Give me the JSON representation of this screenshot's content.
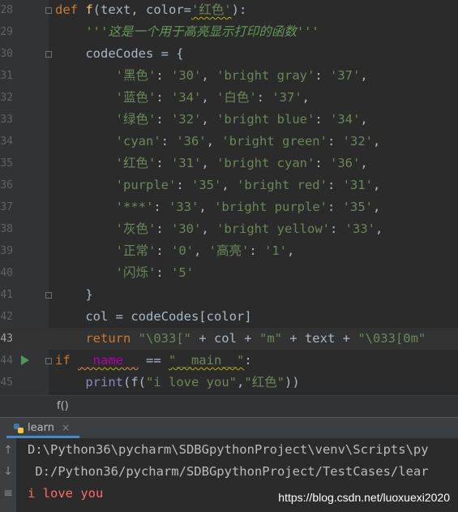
{
  "editor": {
    "lines": [
      {
        "num": "28",
        "tokens": [
          {
            "t": "kw",
            "v": "def "
          },
          {
            "t": "fn",
            "v": "f"
          },
          {
            "t": "id",
            "v": "(text, color="
          },
          {
            "t": "str",
            "v": "'红色'"
          },
          {
            "t": "id",
            "v": "):"
          }
        ]
      },
      {
        "num": "29",
        "tokens": [
          {
            "t": "id",
            "v": "    "
          },
          {
            "t": "doc",
            "v": "'''这是一个用于高亮显示打印的函数'''"
          }
        ]
      },
      {
        "num": "30",
        "tokens": [
          {
            "t": "id",
            "v": "    codeCodes = {"
          }
        ]
      },
      {
        "num": "31",
        "tokens": [
          {
            "t": "id",
            "v": "        "
          },
          {
            "t": "str",
            "v": "'黑色'"
          },
          {
            "t": "id",
            "v": ": "
          },
          {
            "t": "str",
            "v": "'30'"
          },
          {
            "t": "id",
            "v": ", "
          },
          {
            "t": "str",
            "v": "'bright gray'"
          },
          {
            "t": "id",
            "v": ": "
          },
          {
            "t": "str",
            "v": "'37'"
          },
          {
            "t": "id",
            "v": ","
          }
        ]
      },
      {
        "num": "32",
        "tokens": [
          {
            "t": "id",
            "v": "        "
          },
          {
            "t": "str",
            "v": "'蓝色'"
          },
          {
            "t": "id",
            "v": ": "
          },
          {
            "t": "str",
            "v": "'34'"
          },
          {
            "t": "id",
            "v": ", "
          },
          {
            "t": "str",
            "v": "'白色'"
          },
          {
            "t": "id",
            "v": ": "
          },
          {
            "t": "str",
            "v": "'37'"
          },
          {
            "t": "id",
            "v": ","
          }
        ]
      },
      {
        "num": "33",
        "tokens": [
          {
            "t": "id",
            "v": "        "
          },
          {
            "t": "str",
            "v": "'绿色'"
          },
          {
            "t": "id",
            "v": ": "
          },
          {
            "t": "str",
            "v": "'32'"
          },
          {
            "t": "id",
            "v": ", "
          },
          {
            "t": "str",
            "v": "'bright blue'"
          },
          {
            "t": "id",
            "v": ": "
          },
          {
            "t": "str",
            "v": "'34'"
          },
          {
            "t": "id",
            "v": ","
          }
        ]
      },
      {
        "num": "34",
        "tokens": [
          {
            "t": "id",
            "v": "        "
          },
          {
            "t": "str",
            "v": "'cyan'"
          },
          {
            "t": "id",
            "v": ": "
          },
          {
            "t": "str",
            "v": "'36'"
          },
          {
            "t": "id",
            "v": ", "
          },
          {
            "t": "str",
            "v": "'bright green'"
          },
          {
            "t": "id",
            "v": ": "
          },
          {
            "t": "str",
            "v": "'32'"
          },
          {
            "t": "id",
            "v": ","
          }
        ]
      },
      {
        "num": "35",
        "tokens": [
          {
            "t": "id",
            "v": "        "
          },
          {
            "t": "str",
            "v": "'红色'"
          },
          {
            "t": "id",
            "v": ": "
          },
          {
            "t": "str",
            "v": "'31'"
          },
          {
            "t": "id",
            "v": ", "
          },
          {
            "t": "str",
            "v": "'bright cyan'"
          },
          {
            "t": "id",
            "v": ": "
          },
          {
            "t": "str",
            "v": "'36'"
          },
          {
            "t": "id",
            "v": ","
          }
        ]
      },
      {
        "num": "36",
        "tokens": [
          {
            "t": "id",
            "v": "        "
          },
          {
            "t": "str",
            "v": "'purple'"
          },
          {
            "t": "id",
            "v": ": "
          },
          {
            "t": "str",
            "v": "'35'"
          },
          {
            "t": "id",
            "v": ", "
          },
          {
            "t": "str",
            "v": "'bright red'"
          },
          {
            "t": "id",
            "v": ": "
          },
          {
            "t": "str",
            "v": "'31'"
          },
          {
            "t": "id",
            "v": ","
          }
        ]
      },
      {
        "num": "37",
        "tokens": [
          {
            "t": "id",
            "v": "        "
          },
          {
            "t": "str",
            "v": "'***'"
          },
          {
            "t": "id",
            "v": ": "
          },
          {
            "t": "str",
            "v": "'33'"
          },
          {
            "t": "id",
            "v": ", "
          },
          {
            "t": "str",
            "v": "'bright purple'"
          },
          {
            "t": "id",
            "v": ": "
          },
          {
            "t": "str",
            "v": "'35'"
          },
          {
            "t": "id",
            "v": ","
          }
        ]
      },
      {
        "num": "38",
        "tokens": [
          {
            "t": "id",
            "v": "        "
          },
          {
            "t": "str",
            "v": "'灰色'"
          },
          {
            "t": "id",
            "v": ": "
          },
          {
            "t": "str",
            "v": "'30'"
          },
          {
            "t": "id",
            "v": ", "
          },
          {
            "t": "str",
            "v": "'bright yellow'"
          },
          {
            "t": "id",
            "v": ": "
          },
          {
            "t": "str",
            "v": "'33'"
          },
          {
            "t": "id",
            "v": ","
          }
        ]
      },
      {
        "num": "39",
        "tokens": [
          {
            "t": "id",
            "v": "        "
          },
          {
            "t": "str",
            "v": "'正常'"
          },
          {
            "t": "id",
            "v": ": "
          },
          {
            "t": "str",
            "v": "'0'"
          },
          {
            "t": "id",
            "v": ", "
          },
          {
            "t": "str",
            "v": "'高亮'"
          },
          {
            "t": "id",
            "v": ": "
          },
          {
            "t": "str",
            "v": "'1'"
          },
          {
            "t": "id",
            "v": ","
          }
        ]
      },
      {
        "num": "40",
        "tokens": [
          {
            "t": "id",
            "v": "        "
          },
          {
            "t": "str",
            "v": "'闪烁'"
          },
          {
            "t": "id",
            "v": ": "
          },
          {
            "t": "str",
            "v": "'5'"
          }
        ]
      },
      {
        "num": "41",
        "tokens": [
          {
            "t": "id",
            "v": "    }"
          }
        ]
      },
      {
        "num": "42",
        "tokens": [
          {
            "t": "id",
            "v": "    col = codeCodes[color]"
          }
        ]
      },
      {
        "num": "43",
        "current": true,
        "tokens": [
          {
            "t": "id",
            "v": "    "
          },
          {
            "t": "kw",
            "v": "return "
          },
          {
            "t": "str",
            "v": "\"\\033[\""
          },
          {
            "t": "id",
            "v": " + col + "
          },
          {
            "t": "str",
            "v": "\"m\""
          },
          {
            "t": "id",
            "v": " + text + "
          },
          {
            "t": "str",
            "v": "\"\\033[0m\""
          }
        ]
      },
      {
        "num": "44",
        "run": true,
        "tokens": [
          {
            "t": "kw",
            "v": "if "
          },
          {
            "t": "magic",
            "v": "__name__"
          },
          {
            "t": "id",
            "v": " == "
          },
          {
            "t": "str",
            "v": "\"__main__\""
          },
          {
            "t": "id",
            "v": ":"
          }
        ]
      },
      {
        "num": "45",
        "tokens": [
          {
            "t": "id",
            "v": "    "
          },
          {
            "t": "builtin",
            "v": "print"
          },
          {
            "t": "id",
            "v": "(f("
          },
          {
            "t": "str",
            "v": "\"i love you\""
          },
          {
            "t": "id",
            "v": ","
          },
          {
            "t": "str",
            "v": "\"红色\""
          },
          {
            "t": "id",
            "v": "))"
          }
        ]
      }
    ]
  },
  "breadcrumb": {
    "text": "f()"
  },
  "run_tab": {
    "label": "learn",
    "close": "×"
  },
  "console": {
    "lines": [
      {
        "cls": "c-path",
        "text": "D:\\Python36\\pycharm\\SDBGpythonProject\\venv\\Scripts\\py"
      },
      {
        "cls": "c-path",
        "text": " D:/Python36/pycharm/SDBGpythonProject/TestCases/lear"
      },
      {
        "cls": "c-out",
        "text": "i love you"
      }
    ],
    "buttons": [
      "↑",
      "↓",
      "≡"
    ]
  },
  "watermark": "https://blog.csdn.net/luoxuexi2020",
  "colors": {
    "background": "#2b2b2b",
    "keyword": "#cc7832",
    "string": "#6a8759",
    "function": "#ffc66d",
    "output_red": "#ff6b68",
    "run_green": "#499c54"
  }
}
